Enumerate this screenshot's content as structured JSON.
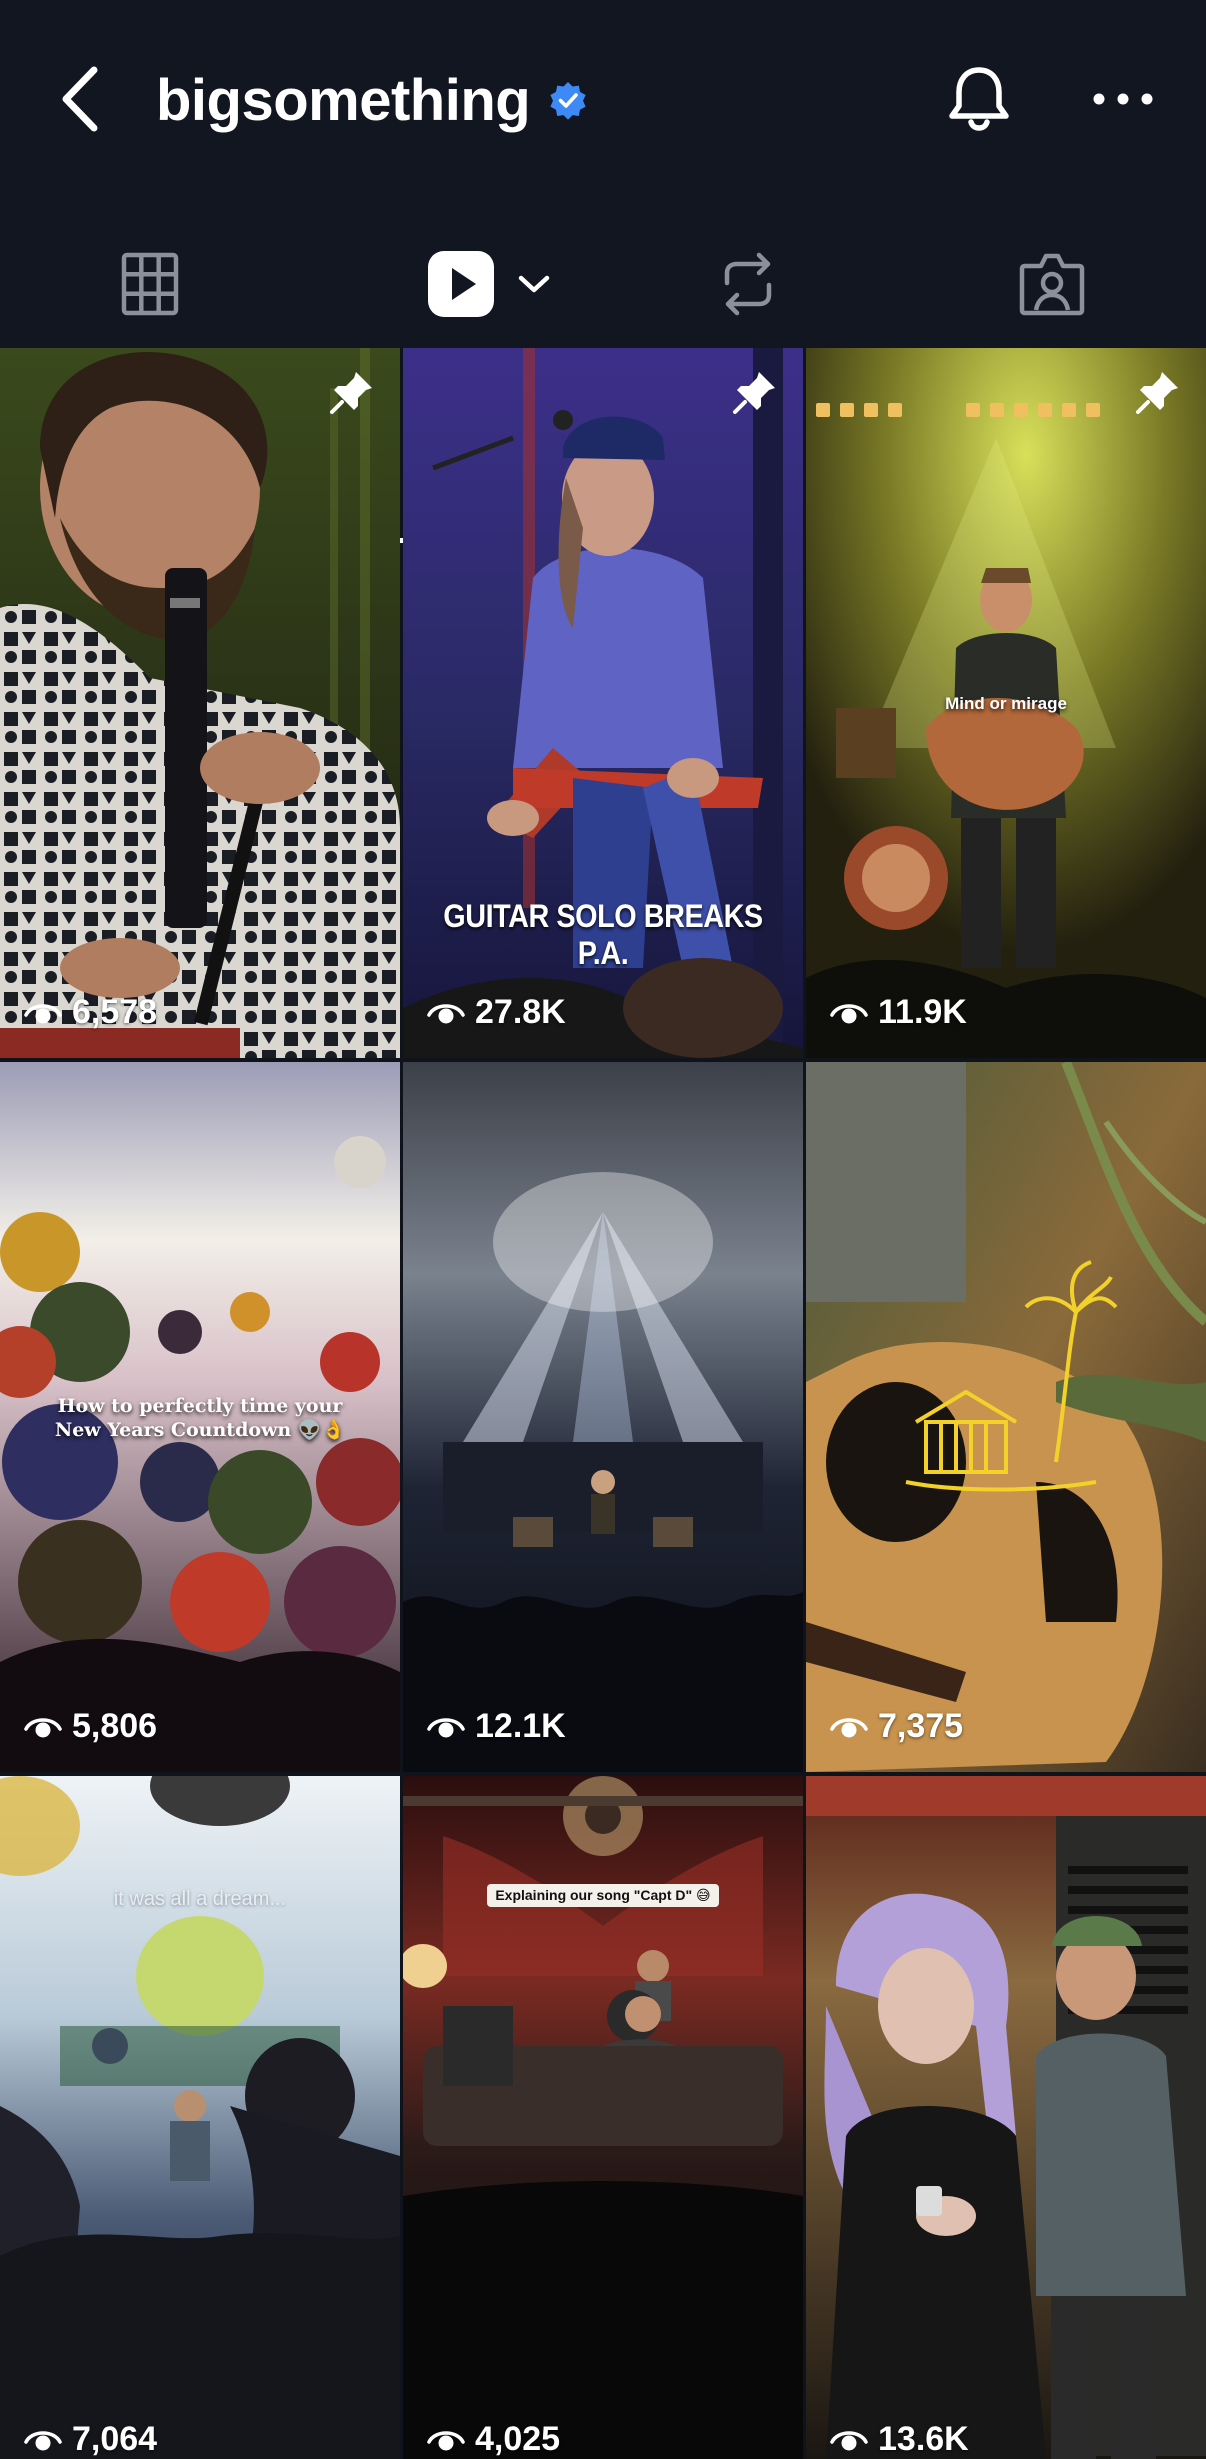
{
  "header": {
    "username": "bigsomething",
    "icons": {
      "back": "chevron-left-icon",
      "verified": "verified-badge-icon",
      "bell": "bell-icon",
      "more": "more-dots-icon"
    },
    "verified_color": "#3d8af7"
  },
  "tabs": [
    {
      "name": "posts-grid",
      "icon": "grid-icon",
      "selected": false
    },
    {
      "name": "reels",
      "icon": "play-icon",
      "selected": true
    },
    {
      "name": "reposts",
      "icon": "repost-icon",
      "selected": false
    },
    {
      "name": "tagged",
      "icon": "tagged-person-icon",
      "selected": false
    }
  ],
  "reels": [
    {
      "views": "6,578",
      "pinned": true,
      "caption": ""
    },
    {
      "views": "27.8K",
      "pinned": true,
      "caption": "GUITAR SOLO BREAKS P.A."
    },
    {
      "views": "11.9K",
      "pinned": true,
      "caption": "Mind or mirage"
    },
    {
      "views": "5,806",
      "pinned": false,
      "caption": "How to perfectly time your New Years Countdown 👽👌"
    },
    {
      "views": "12.1K",
      "pinned": false,
      "caption": ""
    },
    {
      "views": "7,375",
      "pinned": false,
      "caption": ""
    },
    {
      "views": "7,064",
      "pinned": false,
      "caption": "it was all a dream..."
    },
    {
      "views": "4,025",
      "pinned": false,
      "caption": "Explaining our song \"Capt D\" 😅"
    },
    {
      "views": "13.6K",
      "pinned": false,
      "caption": ""
    }
  ]
}
